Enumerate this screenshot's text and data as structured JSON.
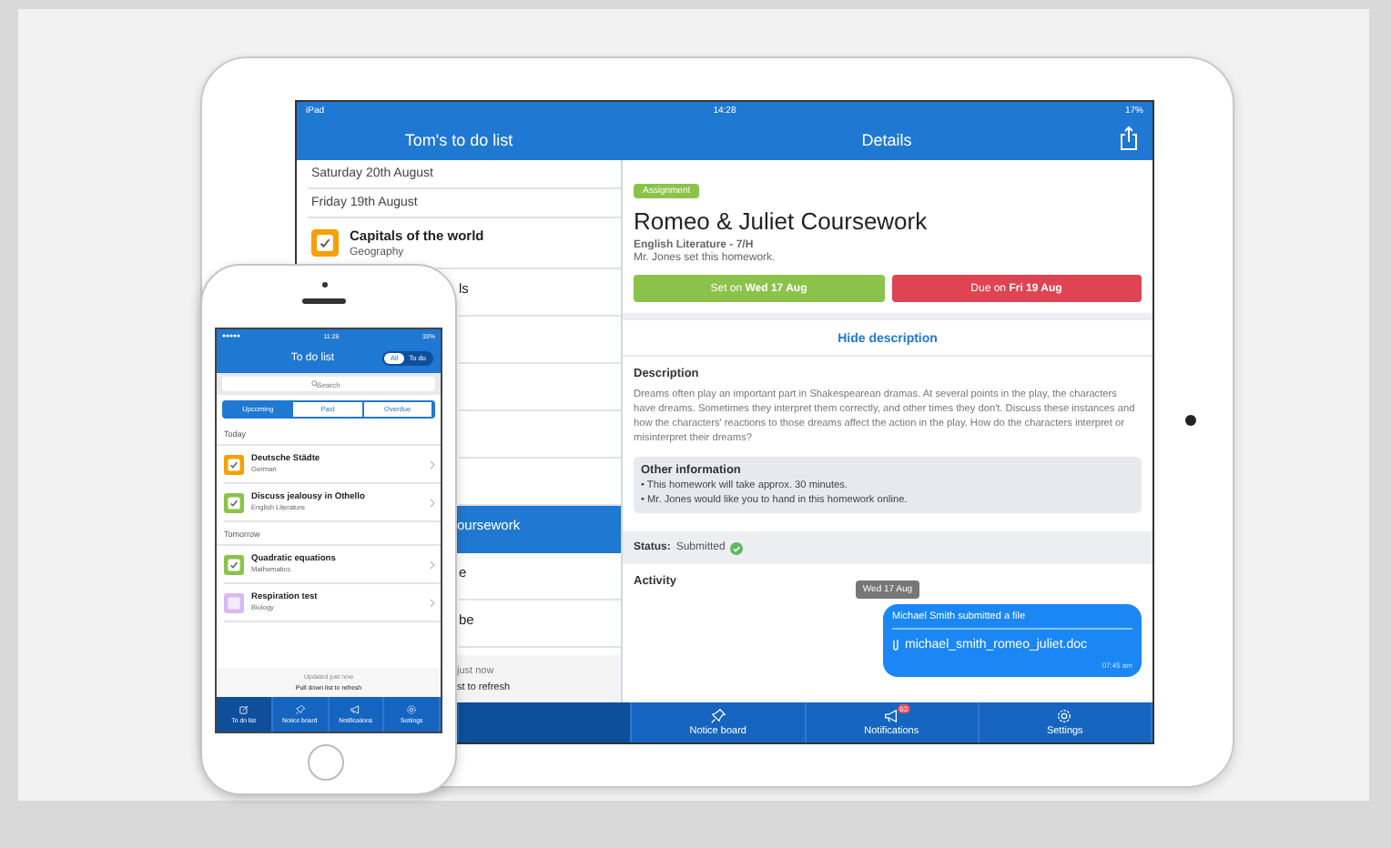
{
  "ipad": {
    "status_bar": {
      "device": "iPad",
      "time": "14:28",
      "battery": "17%"
    },
    "list_pane": {
      "title": "Tom's to do list",
      "rows": [
        {
          "kind": "date",
          "label": "Saturday 20th August"
        },
        {
          "kind": "date",
          "label": "Friday 19th August"
        },
        {
          "kind": "task",
          "title": "Capitals of the world",
          "subject": "Geography",
          "checked": true,
          "color": "#f5a100",
          "selected": false
        },
        {
          "kind": "covered",
          "title": "ls",
          "selected": false
        },
        {
          "kind": "covered",
          "selected": false
        },
        {
          "kind": "covered",
          "selected": false
        },
        {
          "kind": "covered",
          "selected": false
        },
        {
          "kind": "covered",
          "selected": false
        },
        {
          "kind": "covered",
          "title": "oursework",
          "selected": true
        },
        {
          "kind": "covered",
          "title": "e",
          "selected": false
        },
        {
          "kind": "covered",
          "title": "be",
          "selected": false
        }
      ],
      "footer": [
        "just now",
        "st to refresh"
      ]
    },
    "details": {
      "title": "Details",
      "tag": "Assignment",
      "heading": "Romeo & Juliet Coursework",
      "subtitle": "English Literature - 7/H",
      "note": "Mr. Jones set this homework.",
      "set_button": "Set on **Wed 17 Aug**",
      "due_button": "Due on **Fri 19 Aug**",
      "toggle_link": "Hide description",
      "description_heading": "Description",
      "description": "Dreams often play an important part in Shakespearean dramas. At several points in the play, the characters have dreams. Sometimes they interpret them correctly, and other times they don't. Discuss these instances and how the characters' reactions to those dreams affect the action in the play. How do the characters interpret or misinterpret their dreams?",
      "other_info": {
        "heading": "Other information",
        "items": [
          "• This homework will take approx. 30 minutes.",
          "• Mr. Jones would like you to hand in this homework online."
        ]
      },
      "status": {
        "label": "Status:",
        "value": "Submitted"
      },
      "activity": {
        "heading": "Activity",
        "date": "Wed 17 Aug",
        "message": {
          "title": "Michael Smith submitted a file",
          "file": "michael_smith_romeo_juliet.doc",
          "time": "07:45 am"
        }
      }
    },
    "tabs": [
      {
        "selected": true
      },
      {
        "label": "Notice board",
        "selected": false
      },
      {
        "label": "Notifications",
        "badge": "63",
        "selected": false
      },
      {
        "label": "Settings",
        "selected": false
      }
    ]
  },
  "iphone": {
    "status_bar": {
      "time": "11:26",
      "battery": "33%"
    },
    "title": "To do list",
    "filter": [
      {
        "label": "All",
        "selected": true
      },
      {
        "label": "To do",
        "selected": false
      }
    ],
    "search": {
      "placeholder": "Search"
    },
    "segments": [
      {
        "label": "Upcoming",
        "selected": true
      },
      {
        "label": "Past",
        "selected": false
      },
      {
        "label": "Overdue",
        "selected": false
      }
    ],
    "groups": [
      {
        "label": "Today",
        "items": [
          {
            "title": "Deutsche Städte",
            "subject": "German",
            "checked": true,
            "color": "#f5a100",
            "selected": false
          },
          {
            "title": "Discuss jealousy in Othello",
            "subject": "English Literature",
            "checked": true,
            "color": "#8bc34a",
            "selected": false
          }
        ]
      },
      {
        "label": "Tomorrow",
        "items": [
          {
            "title": "Quadratic equations",
            "subject": "Mathematics",
            "checked": true,
            "color": "#8bc34a",
            "selected": false
          },
          {
            "title": "Respiration test",
            "subject": "Biology",
            "checked": false,
            "color": "#d9b8f5",
            "selected": false
          }
        ]
      }
    ],
    "footer": {
      "updated": "Updated just now",
      "hint": "Pull down list to refresh"
    },
    "tabs": [
      {
        "label": "To do list",
        "selected": true
      },
      {
        "label": "Notice board",
        "selected": false
      },
      {
        "label": "Notifications",
        "selected": false
      },
      {
        "label": "Settings",
        "selected": false
      }
    ]
  }
}
